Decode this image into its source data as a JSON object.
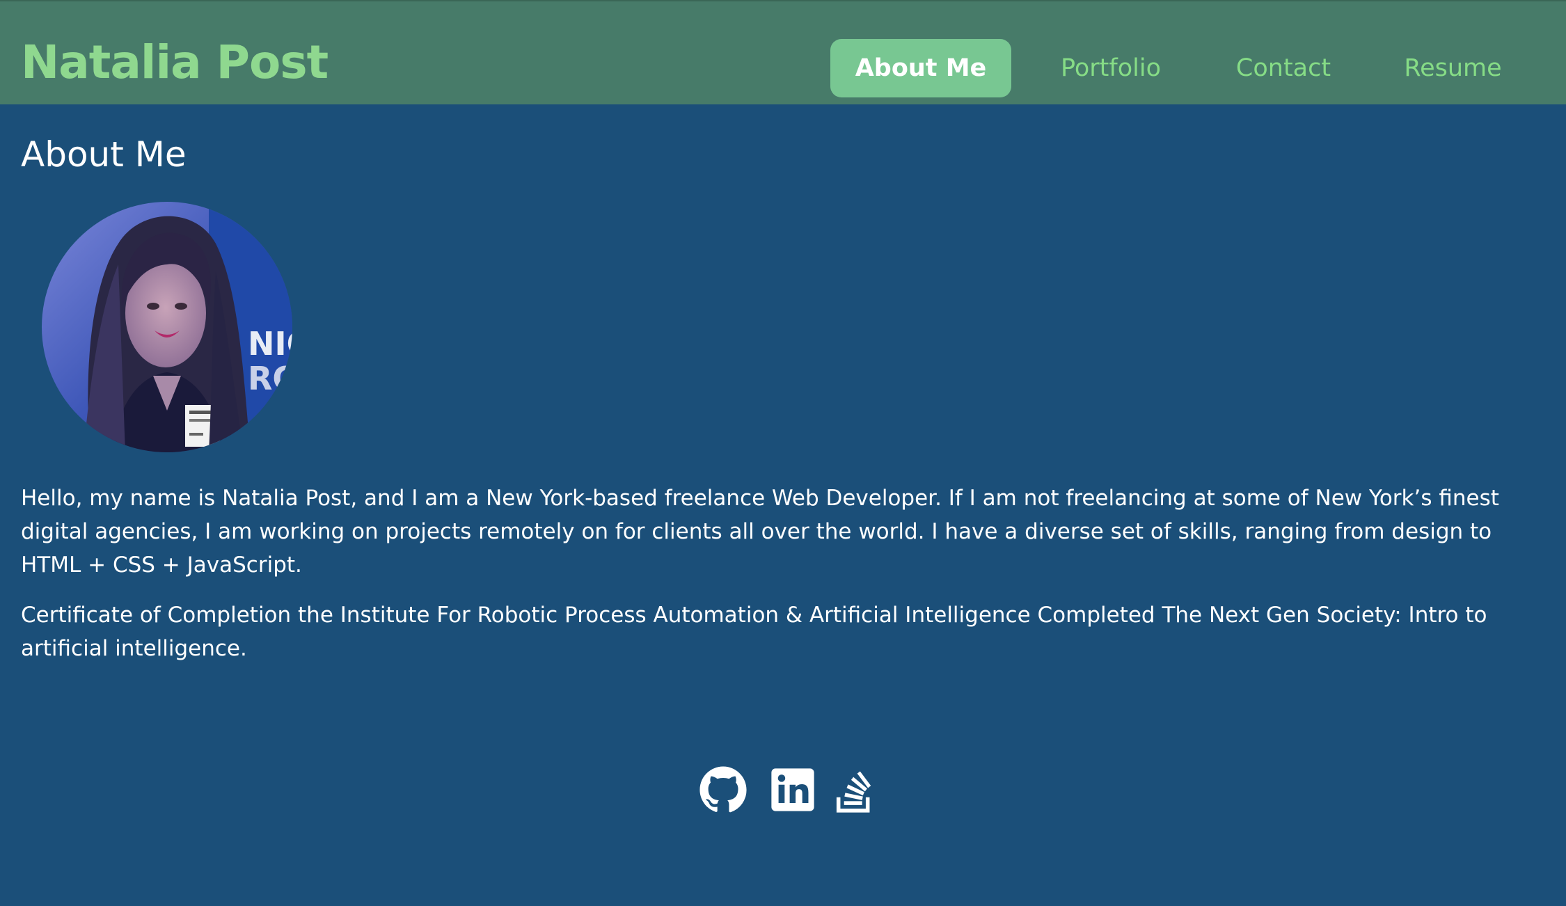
{
  "header": {
    "brand": "Natalia Post",
    "nav": [
      {
        "label": "About Me",
        "active": true
      },
      {
        "label": "Portfolio",
        "active": false
      },
      {
        "label": "Contact",
        "active": false
      },
      {
        "label": "Resume",
        "active": false
      }
    ]
  },
  "main": {
    "title": "About Me",
    "avatar": {
      "name": "profile-photo",
      "alt": "Natalia Post"
    },
    "bio": "Hello, my name is Natalia Post, and I am a New York-based freelance Web Developer. If I am not freelancing at some of New York’s finest digital agencies, I am working on projects remotely on for clients all over the world. I have a diverse set of skills, ranging from design to HTML + CSS + JavaScript.",
    "certificate": "Certificate of Completion the Institute For Robotic Process Automation & Artificial Intelligence Completed The Next Gen Society: Intro to artificial intelligence."
  },
  "footer": {
    "social": [
      {
        "icon": "github-icon"
      },
      {
        "icon": "linkedin-icon"
      },
      {
        "icon": "stackoverflow-icon"
      }
    ]
  },
  "colors": {
    "header_bg": "#477b69",
    "page_bg": "#1b4f79",
    "brand": "#8fd88f",
    "nav_text": "#86dc86",
    "nav_active_bg": "#78c792"
  }
}
